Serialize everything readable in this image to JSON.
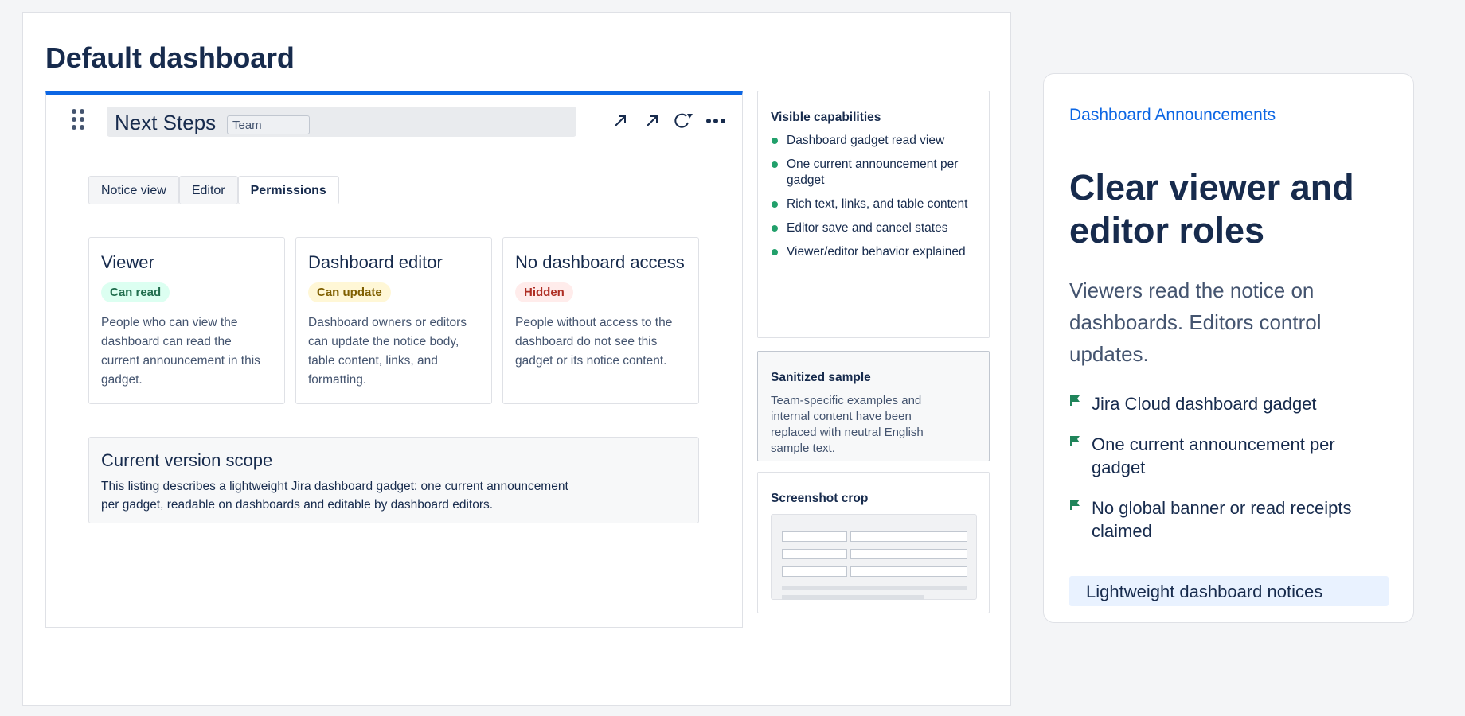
{
  "dashboard": {
    "title": "Default dashboard"
  },
  "gadget": {
    "title": "Next Steps",
    "team_input_value": "Team",
    "tool_icons": [
      "expand-arrow-icon",
      "open-arrow-icon",
      "refresh-icon",
      "more-icon"
    ],
    "tabs": [
      {
        "label": "Notice view",
        "active": false
      },
      {
        "label": "Editor",
        "active": false
      },
      {
        "label": "Permissions",
        "active": true
      }
    ],
    "roles": [
      {
        "title": "Viewer",
        "badge": "Can read",
        "badge_color": "#dcfff1",
        "desc": "People who can view the dashboard can read the current announcement in this gadget."
      },
      {
        "title": "Dashboard editor",
        "badge": "Can update",
        "badge_color": "#fff7d6",
        "desc": "Dashboard owners or editors can update the notice body, table content, links, and formatting."
      },
      {
        "title": "No dashboard access",
        "badge": "Hidden",
        "badge_color": "#ffeceb",
        "desc": "People without access to the dashboard do not see this gadget or its notice content."
      }
    ],
    "scope": {
      "title": "Current version scope",
      "text": "This listing describes a lightweight Jira dashboard gadget: one current announcement per gadget, readable on dashboards and editable by dashboard editors."
    }
  },
  "side": {
    "capabilities": {
      "heading": "Visible capabilities",
      "items": [
        "Dashboard gadget read view",
        "One current announcement per gadget",
        "Rich text, links, and table content",
        "Editor save and cancel states",
        "Viewer/editor behavior explained"
      ]
    },
    "sample": {
      "heading": "Sanitized sample",
      "text": "Team-specific examples and internal content have been replaced with neutral English sample text."
    },
    "crop": {
      "heading": "Screenshot crop"
    }
  },
  "promo": {
    "link": "Dashboard Announcements",
    "title": "Clear viewer and editor roles",
    "subtitle": "Viewers read the notice on dashboards. Editors control updates.",
    "bullets": [
      "Jira Cloud dashboard gadget",
      "One current announcement per gadget",
      "No global banner or read receipts claimed"
    ],
    "chip": "Lightweight dashboard notices",
    "accent": "#0c66e4",
    "bullet_color": "#22a06b"
  }
}
